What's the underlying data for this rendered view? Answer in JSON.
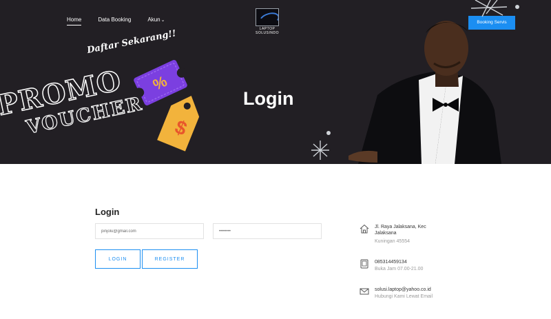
{
  "nav": {
    "items": [
      {
        "label": "Home"
      },
      {
        "label": "Data Booking"
      },
      {
        "label": "Akun"
      }
    ]
  },
  "logo": {
    "line1": "LAPTOP",
    "line2": "SOLUSINDO"
  },
  "booking_button": "Booking Servis",
  "hero": {
    "title": "Login",
    "promo_tagline": "Daftar Sekarang!!",
    "promo_line1": "PROMO",
    "promo_line2": "VOUCHER",
    "ticket_symbol": "%",
    "tag_symbol": "$"
  },
  "form": {
    "title": "Login",
    "email_value": "pinjolu@gmail.com",
    "password_value": "••••••••",
    "login_label": "LOGIN",
    "register_label": "REGISTER"
  },
  "contact": {
    "address": {
      "line1": "Jl. Raya Jalaksana, Kec",
      "line2": "Jalaksana",
      "line3": "Kuningan 45554",
      "icon": "home-icon"
    },
    "phone": {
      "line1": "085314459134",
      "line2": "Buka Jam 07.00-21.00",
      "icon": "tablet-icon"
    },
    "email": {
      "line1": "solusi.laptop@yahoo.co.id",
      "line2": "Hubungi Kami Lewat Email",
      "icon": "mail-icon"
    }
  },
  "colors": {
    "hero_bg": "#221f24",
    "accent": "#1b8ef2",
    "ticket": "#7b3fe0",
    "tag": "#f2b33c"
  }
}
